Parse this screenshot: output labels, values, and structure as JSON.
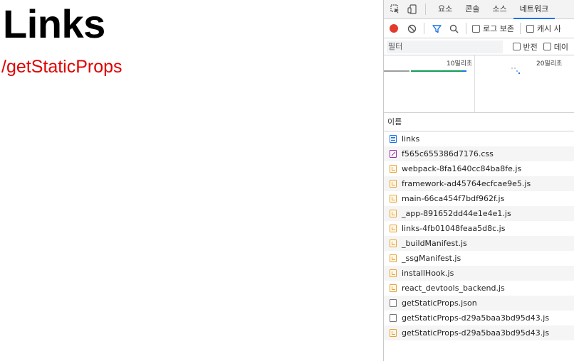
{
  "page": {
    "title": "Links",
    "link_text": "/getStaticProps"
  },
  "devtools": {
    "tabs": [
      "요소",
      "콘솔",
      "소스",
      "네트워크"
    ],
    "active_tab": "네트워크",
    "toolbar": {
      "preserve_log": "로그 보존",
      "disable_cache": "캐시 사"
    },
    "filter": {
      "placeholder": "필터",
      "invert": "반전",
      "data_urls": "데이"
    },
    "overview": {
      "tick_1": "10밀리초",
      "tick_2": "20밀리초"
    },
    "list": {
      "column_name": "이름",
      "requests": [
        {
          "name": "links",
          "type": "doc"
        },
        {
          "name": "f565c655386d7176.css",
          "type": "css"
        },
        {
          "name": "webpack-8fa1640cc84ba8fe.js",
          "type": "js"
        },
        {
          "name": "framework-ad45764ecfcae9e5.js",
          "type": "js"
        },
        {
          "name": "main-66ca454f7bdf962f.js",
          "type": "js"
        },
        {
          "name": "_app-891652dd44e1e4e1.js",
          "type": "js"
        },
        {
          "name": "links-4fb01048feaa5d8c.js",
          "type": "js"
        },
        {
          "name": "_buildManifest.js",
          "type": "js"
        },
        {
          "name": "_ssgManifest.js",
          "type": "js"
        },
        {
          "name": "installHook.js",
          "type": "js"
        },
        {
          "name": "react_devtools_backend.js",
          "type": "js"
        },
        {
          "name": "getStaticProps.json",
          "type": "json"
        },
        {
          "name": "getStaticProps-d29a5baa3bd95d43.js",
          "type": "json"
        },
        {
          "name": "getStaticProps-d29a5baa3bd95d43.js",
          "type": "js"
        }
      ]
    },
    "colors": {
      "accent": "#1a73e8",
      "record": "#e33a2e",
      "link": "#e00000"
    }
  }
}
